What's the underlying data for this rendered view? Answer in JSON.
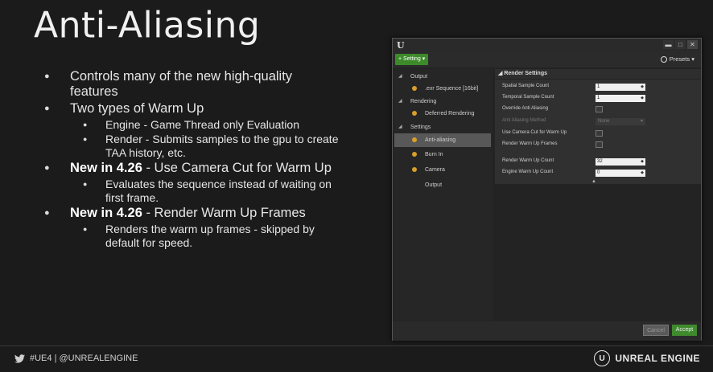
{
  "slide": {
    "title": "Anti-Aliasing",
    "bullets": [
      {
        "text": "Controls many of the new high-quality features"
      },
      {
        "text": "Two types of Warm Up",
        "sub": [
          "Engine - Game Thread only Evaluation",
          "Render - Submits samples to the gpu to create TAA history, etc."
        ]
      },
      {
        "bold": "New in 4.26",
        "text": " - Use Camera Cut for Warm Up",
        "sub": [
          "Evaluates the sequence instead of waiting on first frame."
        ]
      },
      {
        "bold": "New in 4.26",
        "text": " - Render Warm Up Frames",
        "sub": [
          "Renders the warm up frames - skipped by default for speed."
        ]
      }
    ]
  },
  "footer": {
    "handle": "#UE4 | @UNREALENGINE",
    "brand": "UNREAL ENGINE",
    "brand_logo": "U"
  },
  "window": {
    "logo": "U",
    "buttons": {
      "minimize": "▬",
      "maximize": "□",
      "close": "✕"
    },
    "toolbar": {
      "setting_label": "+ Setting ▾",
      "presets_label": "Presets ▾"
    },
    "tree": {
      "output_header": "Output",
      "exr": ".exr Sequence [16bit]",
      "rendering_header": "Rendering",
      "deferred": "Deferred Rendering",
      "settings_header": "Settings",
      "antialiasing": "Anti-aliasing",
      "burnin": "Burn In",
      "camera": "Camera",
      "output": "Output"
    },
    "render_settings": {
      "header": "Render Settings",
      "spatial_label": "Spatial Sample Count",
      "spatial_value": "1",
      "temporal_label": "Temporal Sample Count",
      "temporal_value": "1",
      "override_label": "Override Anti Aliasing",
      "aa_method_label": "Anti Aliasing Method",
      "aa_method_value": "None",
      "camera_cut_label": "Use Camera Cut for Warm Up",
      "warmup_frames_label": "Render Warm Up Frames",
      "render_warmup_count_label": "Render Warm Up Count",
      "render_warmup_count_value": "32",
      "engine_warmup_count_label": "Engine Warm Up Count",
      "engine_warmup_count_value": "0"
    },
    "footer_buttons": {
      "cancel": "Cancel",
      "accept": "Accept"
    }
  },
  "colors": {
    "accent_green": "#3d8a2a",
    "selection": "#585858",
    "dot_yellow": "#d8a02a"
  }
}
